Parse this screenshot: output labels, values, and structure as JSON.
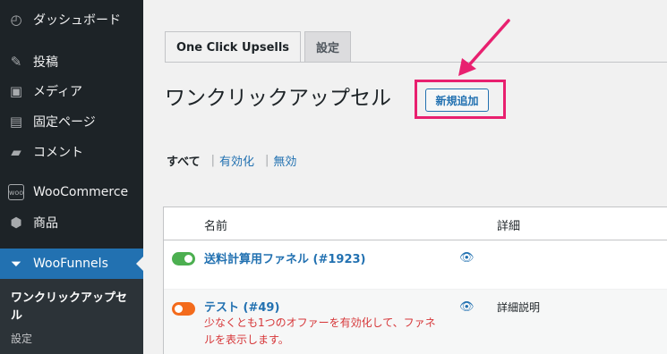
{
  "sidebar": {
    "items": [
      {
        "label": "ダッシュボード",
        "icon": "dashboard-icon"
      },
      {
        "label": "投稿",
        "icon": "pin-icon"
      },
      {
        "label": "メディア",
        "icon": "media-icon"
      },
      {
        "label": "固定ページ",
        "icon": "page-icon"
      },
      {
        "label": "コメント",
        "icon": "comment-icon"
      },
      {
        "label": "WooCommerce",
        "icon": "woocommerce-icon"
      },
      {
        "label": "商品",
        "icon": "product-box-icon"
      },
      {
        "label": "WooFunnels",
        "icon": "funnel-icon"
      }
    ],
    "submenu": {
      "current": "ワンクリックアップセル",
      "settings": "設定"
    }
  },
  "tabs": [
    {
      "label": "One Click Upsells",
      "active": true
    },
    {
      "label": "設定",
      "active": false
    }
  ],
  "page": {
    "title": "ワンクリックアップセル",
    "add_new": "新規追加"
  },
  "filters": {
    "all": "すべて",
    "active": "有効化",
    "inactive": "無効",
    "separator": "|"
  },
  "table": {
    "headers": {
      "name": "名前",
      "detail": "詳細"
    },
    "rows": [
      {
        "title": "送料計算用ファネル (#1923)",
        "enabled": true,
        "detail": "",
        "error": ""
      },
      {
        "title": "テスト (#49)",
        "enabled": false,
        "detail": "詳細説明",
        "error": "少なくとも1つのオファーを有効化して、ファネルを表示します。"
      }
    ]
  },
  "colors": {
    "sidebar_bg": "#1d2327",
    "active_menu": "#2271b1",
    "highlight_box": "#e8206f",
    "toggle_on": "#4caf50",
    "toggle_off": "#f36b1c",
    "error_text": "#d63638"
  }
}
